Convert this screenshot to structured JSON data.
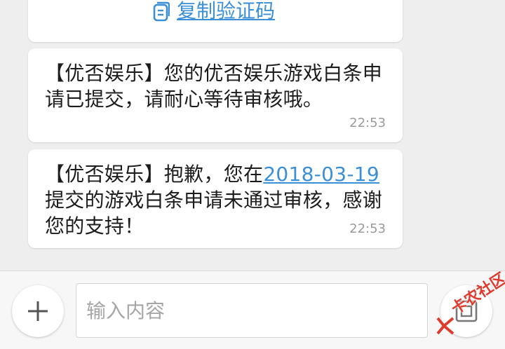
{
  "thread": {
    "copy_code": {
      "label": "复制验证码",
      "icon": "copy-icon"
    },
    "messages": [
      {
        "text": "【优否娱乐】您的优否娱乐游戏白条申请已提交，请耐心等待审核哦。",
        "time": "22:53"
      },
      {
        "text_before": "【优否娱乐】抱歉，您在",
        "date_link": "2018-03-19",
        "text_after": "提交的游戏白条申请未通过审核，感谢您的支持！",
        "time": "22:53"
      }
    ]
  },
  "composer": {
    "add_icon": "plus-icon",
    "input_placeholder": "输入内容",
    "send_icon": "send-icon"
  },
  "watermark": {
    "text": "卡农社区",
    "icon": "k-logo-icon"
  },
  "colors": {
    "link": "#3a8fd6",
    "background": "#eeeeee",
    "bubble": "#ffffff",
    "timestamp": "#9a9a9a",
    "watermark": "#e03a2c"
  }
}
